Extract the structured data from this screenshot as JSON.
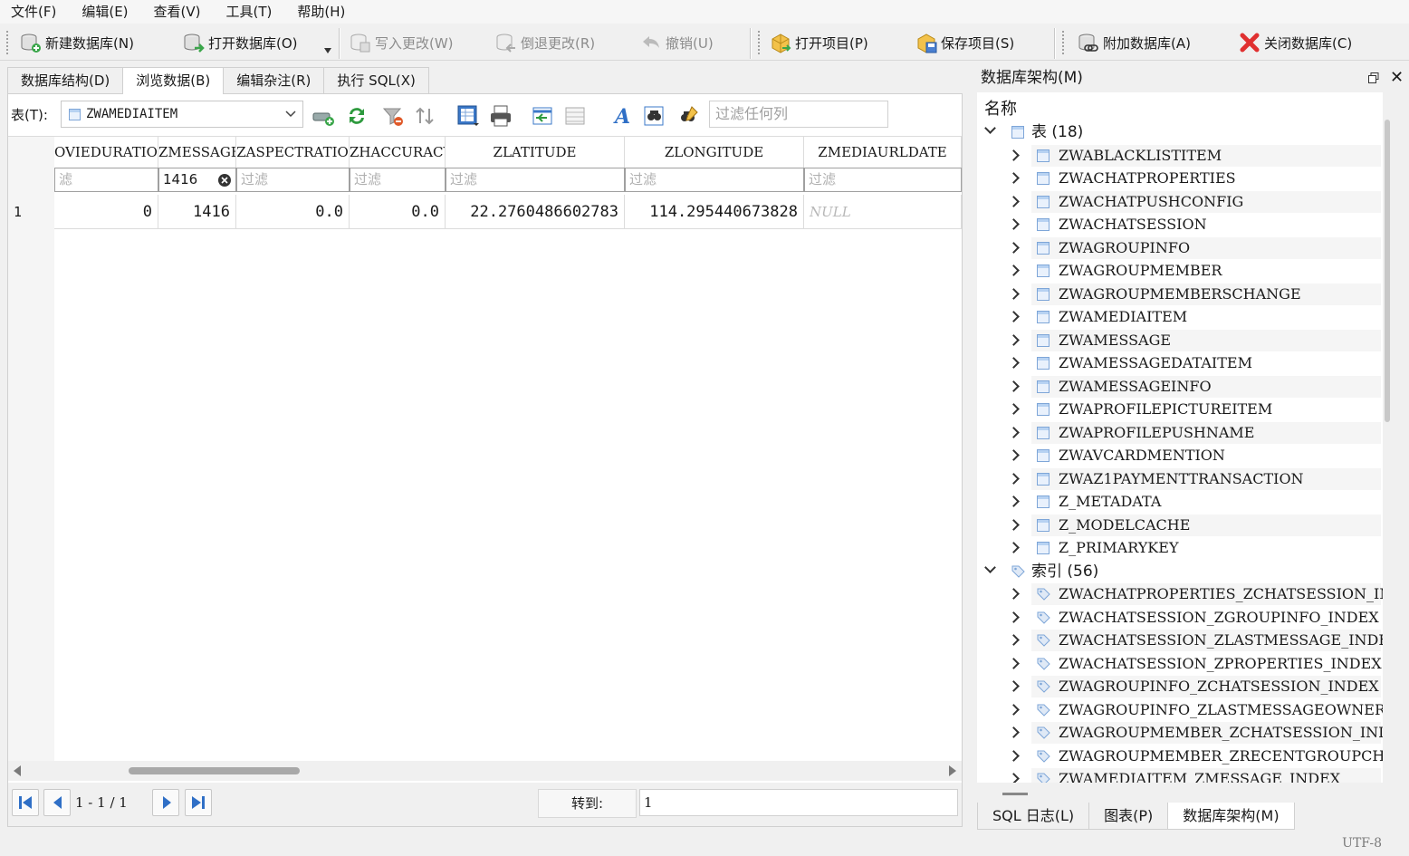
{
  "menu": [
    "文件(F)",
    "编辑(E)",
    "查看(V)",
    "工具(T)",
    "帮助(H)"
  ],
  "toolbar": {
    "new_db": "新建数据库(N)",
    "open_db": "打开数据库(O)",
    "write_changes": "写入更改(W)",
    "revert_changes": "倒退更改(R)",
    "undo": "撤销(U)",
    "open_project": "打开项目(P)",
    "save_project": "保存项目(S)",
    "attach_db": "附加数据库(A)",
    "close_db": "关闭数据库(C)"
  },
  "tabs": [
    "数据库结构(D)",
    "浏览数据(B)",
    "编辑杂注(R)",
    "执行 SQL(X)"
  ],
  "browse": {
    "table_label": "表(T):",
    "table_selected": "ZWAMEDIAITEM",
    "filter_all_placeholder": "过滤任何列",
    "columns": [
      "OVIEDURATION",
      "ZMESSAGE",
      "ZASPECTRATIO",
      "ZHACCURACY",
      "ZLATITUDE",
      "ZLONGITUDE",
      "ZMEDIAURLDATE"
    ],
    "filters": [
      "滤",
      "1416",
      "过滤",
      "过滤",
      "过滤",
      "过滤",
      "过滤"
    ],
    "rows": [
      {
        "num": "1",
        "cells": [
          "0",
          "1416",
          "0.0",
          "0.0",
          "22.2760486602783",
          "114.295440673828",
          "NULL"
        ]
      }
    ]
  },
  "pager": {
    "info": "1 - 1 / 1",
    "goto_label": "转到:",
    "goto_value": "1"
  },
  "schema_panel": {
    "title": "数据库架构(M)",
    "header": "名称",
    "tables_group": "表 (18)",
    "tables": [
      "ZWABLACKLISTITEM",
      "ZWACHATPROPERTIES",
      "ZWACHATPUSHCONFIG",
      "ZWACHATSESSION",
      "ZWAGROUPINFO",
      "ZWAGROUPMEMBER",
      "ZWAGROUPMEMBERSCHANGE",
      "ZWAMEDIAITEM",
      "ZWAMESSAGE",
      "ZWAMESSAGEDATAITEM",
      "ZWAMESSAGEINFO",
      "ZWAPROFILEPICTUREITEM",
      "ZWAPROFILEPUSHNAME",
      "ZWAVCARDMENTION",
      "ZWAZ1PAYMENTTRANSACTION",
      "Z_METADATA",
      "Z_MODELCACHE",
      "Z_PRIMARYKEY"
    ],
    "indexes_group": "索引 (56)",
    "indexes": [
      "ZWACHATPROPERTIES_ZCHATSESSION_INDEX",
      "ZWACHATSESSION_ZGROUPINFO_INDEX",
      "ZWACHATSESSION_ZLASTMESSAGE_INDEX",
      "ZWACHATSESSION_ZPROPERTIES_INDEX",
      "ZWAGROUPINFO_ZCHATSESSION_INDEX",
      "ZWAGROUPINFO_ZLASTMESSAGEOWNER_INDEX",
      "ZWAGROUPMEMBER_ZCHATSESSION_INDEX",
      "ZWAGROUPMEMBER_ZRECENTGROUPCHAT_INDEX",
      "ZWAMEDIAITEM_ZMESSAGE_INDEX"
    ],
    "bottom_tabs": [
      "SQL 日志(L)",
      "图表(P)",
      "数据库架构(M)"
    ]
  },
  "status": {
    "encoding": "UTF-8"
  },
  "colors": {
    "accent_blue": "#2f6fc6",
    "close_red": "#e03030",
    "green": "#2e9a3e"
  }
}
